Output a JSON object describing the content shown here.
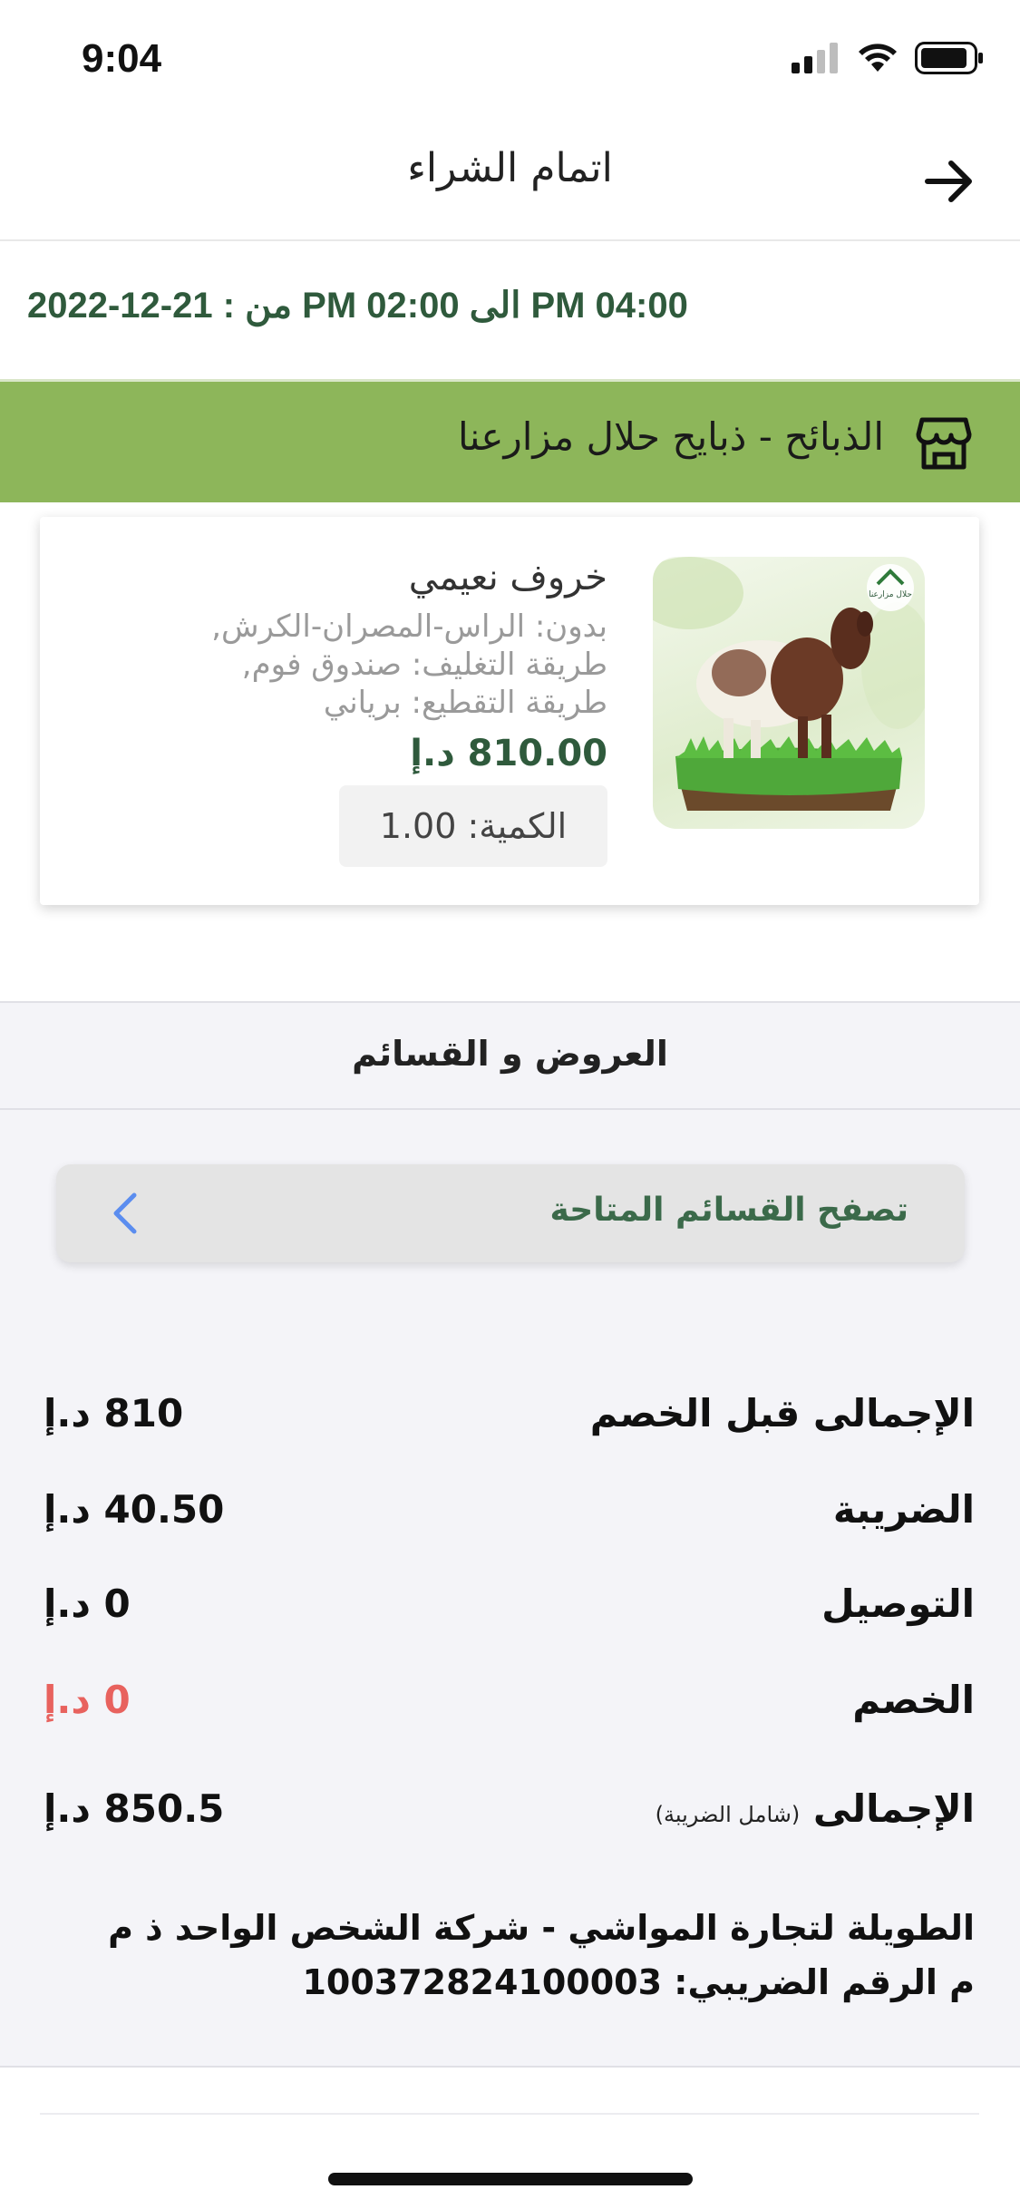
{
  "status_bar": {
    "time": "9:04"
  },
  "nav": {
    "title": "اتمام الشراء",
    "back_icon": "arrow-right-icon"
  },
  "delivery_slot": {
    "text": "2022-12-21 : من PM 02:00 الى PM 04:00"
  },
  "store": {
    "name": "الذبائح - ذبايح حلال مزارعنا",
    "icon": "store-icon",
    "color": "#8db65a"
  },
  "product": {
    "name": "خروف نعيمي",
    "options": [
      "بدون: الراس-المصران-الكرش,",
      "طريقة التغليف: صندوق فوم,",
      "طريقة التقطيع: برياني"
    ],
    "price": "810.00 د.إ",
    "quantity": "الكمية: 1.00",
    "logo_text": "حلال مزارعنا"
  },
  "offers": {
    "title": "العروض و القسائم",
    "coupon_button": "تصفح القسائم المتاحة"
  },
  "summary": {
    "subtotal_label": "الإجمالى قبل الخصم",
    "subtotal_value": "810 د.إ",
    "tax_label": "الضريبة",
    "tax_value": "40.50 د.إ",
    "delivery_label": "التوصيل",
    "delivery_value": "0 د.إ",
    "discount_label": "الخصم",
    "discount_value": "0 د.إ",
    "total_label": "الإجمالى",
    "total_sub": "(شامل الضريبة)",
    "total_value": "850.5 د.إ"
  },
  "company": {
    "line1": "الطويلة لتجارة المواشي - شركة الشخص الواحد ذ م",
    "line2": "م الرقم الضريبي: 100372824100003"
  },
  "colors": {
    "accent_green": "#2f5a3c",
    "store_green": "#8db65a",
    "discount_red": "#e8625e",
    "chevron_blue": "#5b8def"
  }
}
